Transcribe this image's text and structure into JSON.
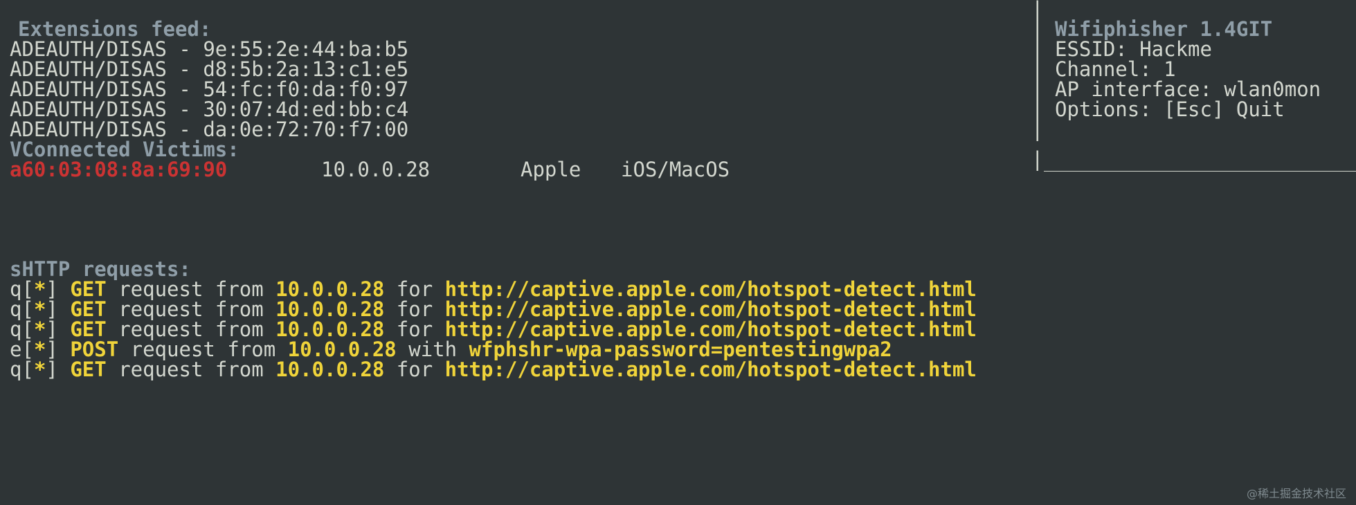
{
  "extensions": {
    "title": "Extensions feed:",
    "lines": [
      "ADEAUTH/DISAS - 9e:55:2e:44:ba:b5",
      "ADEAUTH/DISAS - d8:5b:2a:13:c1:e5",
      "ADEAUTH/DISAS - 54:fc:f0:da:f0:97",
      "ADEAUTH/DISAS - 30:07:4d:ed:bb:c4",
      "ADEAUTH/DISAS - da:0e:72:70:f7:00"
    ]
  },
  "victims": {
    "title": "VConnected Victims:",
    "rows": [
      {
        "mac": "a60:03:08:8a:69:90",
        "ip": "10.0.0.28",
        "vendor": "Apple",
        "os": "iOS/MacOS"
      }
    ]
  },
  "info_panel": {
    "title": "Wifiphisher 1.4GIT",
    "essid": "ESSID: Hackme",
    "channel": "Channel: 1",
    "ap_interface": "AP interface: wlan0mon",
    "options": "Options: [Esc] Quit"
  },
  "http": {
    "title": "sHTTP requests:",
    "lines": [
      {
        "prefix": "q",
        "marker": "*",
        "method": "GET",
        "mid": "request from",
        "ip": "10.0.0.28",
        "conj": "for",
        "target": "http://captive.apple.com/hotspot-detect.html"
      },
      {
        "prefix": "q",
        "marker": "*",
        "method": "GET",
        "mid": "request from",
        "ip": "10.0.0.28",
        "conj": "for",
        "target": "http://captive.apple.com/hotspot-detect.html"
      },
      {
        "prefix": "q",
        "marker": "*",
        "method": "GET",
        "mid": "request from",
        "ip": "10.0.0.28",
        "conj": "for",
        "target": "http://captive.apple.com/hotspot-detect.html"
      },
      {
        "prefix": "e",
        "marker": "*",
        "method": "POST",
        "mid": "request from",
        "ip": "10.0.0.28",
        "conj": "with",
        "target": "wfphshr-wpa-password=pentestingwpa2"
      },
      {
        "prefix": "q",
        "marker": "*",
        "method": "GET",
        "mid": "request from",
        "ip": "10.0.0.28",
        "conj": "for",
        "target": "http://captive.apple.com/hotspot-detect.html"
      }
    ]
  },
  "watermark": "@稀土掘金技术社区",
  "colors": {
    "background": "#2e3436",
    "text": "#d3d7cf",
    "heading": "#8f9ea8",
    "victim_mac": "#cc3333",
    "highlight": "#f0d43a"
  }
}
